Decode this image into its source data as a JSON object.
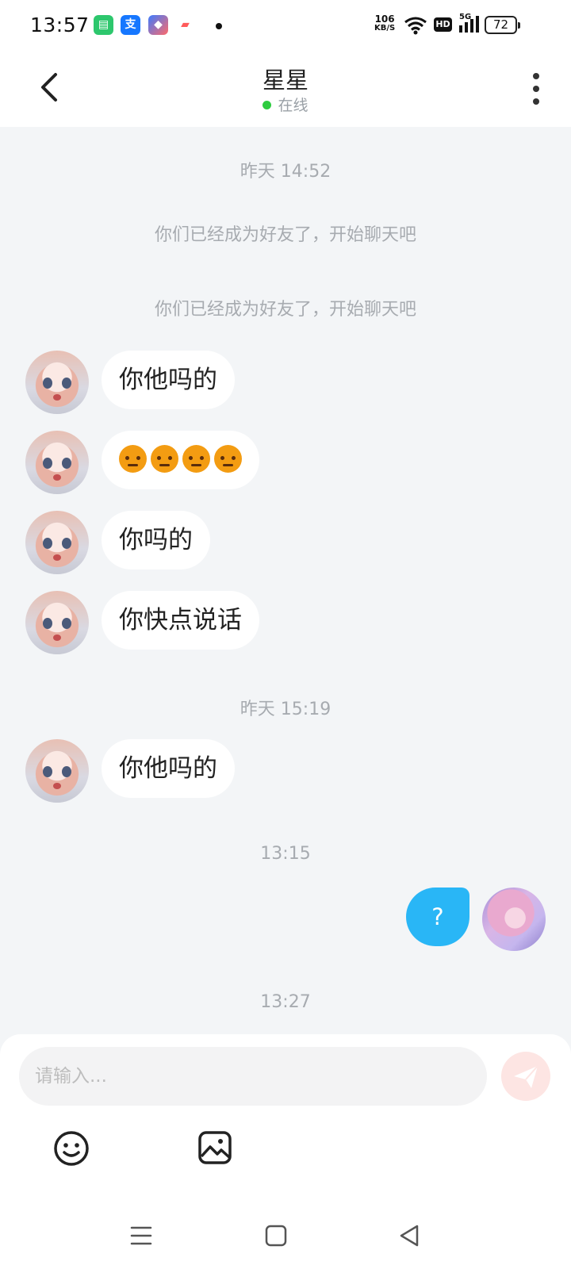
{
  "status_bar": {
    "time": "13:57",
    "net_speed_value": "106",
    "net_speed_unit": "KB/S",
    "hd_badge": "HD",
    "network": "5G",
    "battery": "72",
    "app_icons": [
      "messages-app-icon",
      "alipay-app-icon",
      "app-icon",
      "game-app-icon"
    ]
  },
  "header": {
    "title": "星星",
    "status": "在线",
    "status_color": "#2ecc40"
  },
  "chat": {
    "timestamps": [
      "昨天 14:52",
      "昨天 15:19",
      "13:15",
      "13:27"
    ],
    "system_messages": [
      "你们已经成为好友了，开始聊天吧",
      "你们已经成为好友了，开始聊天吧"
    ],
    "received": [
      {
        "text": "你他吗的"
      },
      {
        "text": "😡😡😡😡"
      },
      {
        "text": "你吗的"
      },
      {
        "text": "你快点说话"
      },
      {
        "text": "你他吗的"
      }
    ],
    "sent": [
      {
        "text": "?"
      }
    ],
    "sent_bubble_color": "#29b6f6"
  },
  "composer": {
    "placeholder": "请输入...",
    "send_button_color": "#fde5e3"
  },
  "nav_bar": {
    "buttons": [
      "menu-icon",
      "home-icon",
      "back-triangle-icon"
    ]
  }
}
